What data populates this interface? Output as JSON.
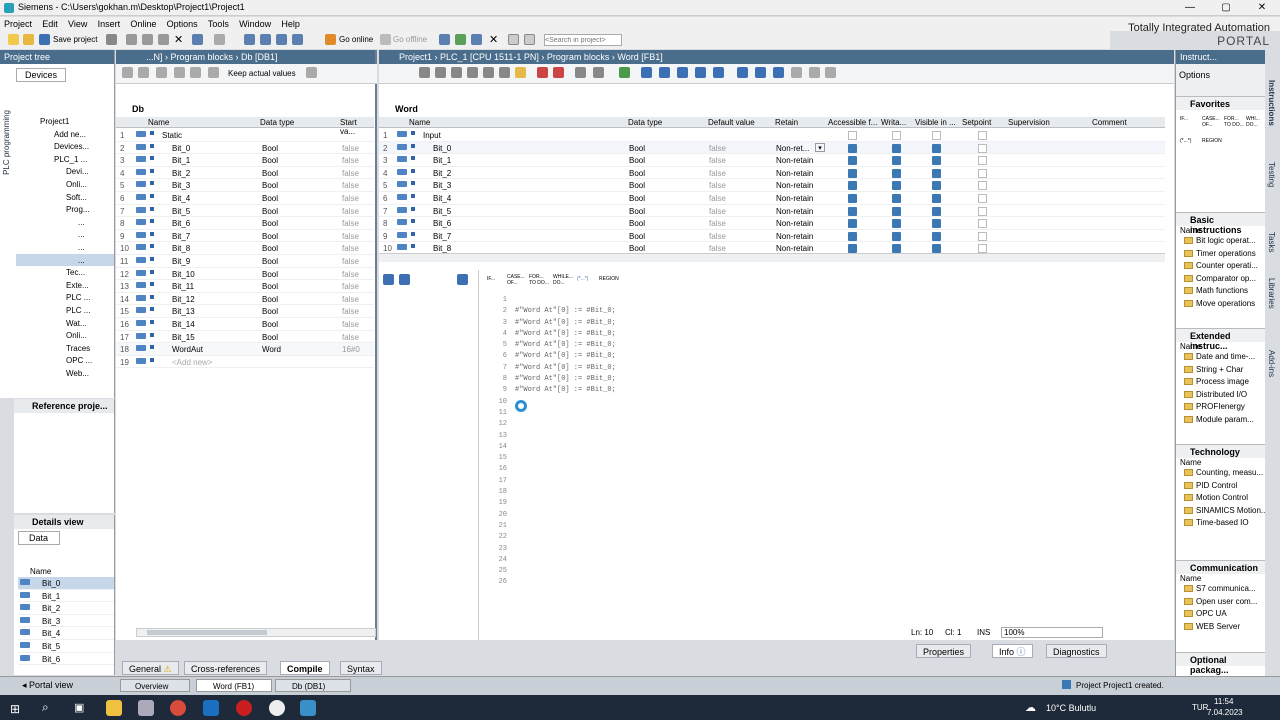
{
  "window": {
    "title": "Siemens  -  C:\\Users\\gokhan.m\\Desktop\\Project1\\Project1"
  },
  "menu": [
    "Project",
    "Edit",
    "View",
    "Insert",
    "Online",
    "Options",
    "Tools",
    "Window",
    "Help"
  ],
  "toolbar": {
    "save": "Save project",
    "go_online": "Go online",
    "go_offline": "Go offline",
    "search_placeholder": "<Search in project>"
  },
  "brand": {
    "line1": "Totally Integrated Automation",
    "line2": "PORTAL"
  },
  "project_tree": {
    "title": "Project tree",
    "devices_tab": "Devices",
    "side_label": "PLC programming",
    "items": [
      "Project1",
      "Add ne...",
      "Devices...",
      "PLC_1 ...",
      "Devi...",
      "Onli...",
      "Soft...",
      "Prog...",
      "...",
      "...",
      "...",
      "...",
      "Tec...",
      "Exte...",
      "PLC ...",
      "PLC ...",
      "Wat...",
      "Onli...",
      "Traces",
      "OPC ...",
      "Web..."
    ]
  },
  "reference": {
    "title": "Reference proje..."
  },
  "details": {
    "title": "Details view",
    "tab": "Data",
    "col": "Name",
    "items": [
      "Bit_0",
      "Bit_1",
      "Bit_2",
      "Bit_3",
      "Bit_4",
      "Bit_5",
      "Bit_6"
    ]
  },
  "db_editor": {
    "breadcrumb": "...N]  ›  Program blocks  ›  Db [DB1]",
    "keep_actual": "Keep actual values",
    "block_name": "Db",
    "cols": [
      "Name",
      "Data type",
      "Start va..."
    ],
    "rows": [
      {
        "n": "1",
        "name": "Static",
        "type": "",
        "start": ""
      },
      {
        "n": "2",
        "name": "Bit_0",
        "type": "Bool",
        "start": "false"
      },
      {
        "n": "3",
        "name": "Bit_1",
        "type": "Bool",
        "start": "false"
      },
      {
        "n": "4",
        "name": "Bit_2",
        "type": "Bool",
        "start": "false"
      },
      {
        "n": "5",
        "name": "Bit_3",
        "type": "Bool",
        "start": "false"
      },
      {
        "n": "6",
        "name": "Bit_4",
        "type": "Bool",
        "start": "false"
      },
      {
        "n": "7",
        "name": "Bit_5",
        "type": "Bool",
        "start": "false"
      },
      {
        "n": "8",
        "name": "Bit_6",
        "type": "Bool",
        "start": "false"
      },
      {
        "n": "9",
        "name": "Bit_7",
        "type": "Bool",
        "start": "false"
      },
      {
        "n": "10",
        "name": "Bit_8",
        "type": "Bool",
        "start": "false"
      },
      {
        "n": "11",
        "name": "Bit_9",
        "type": "Bool",
        "start": "false"
      },
      {
        "n": "12",
        "name": "Bit_10",
        "type": "Bool",
        "start": "false"
      },
      {
        "n": "13",
        "name": "Bit_11",
        "type": "Bool",
        "start": "false"
      },
      {
        "n": "14",
        "name": "Bit_12",
        "type": "Bool",
        "start": "false"
      },
      {
        "n": "15",
        "name": "Bit_13",
        "type": "Bool",
        "start": "false"
      },
      {
        "n": "16",
        "name": "Bit_14",
        "type": "Bool",
        "start": "false"
      },
      {
        "n": "17",
        "name": "Bit_15",
        "type": "Bool",
        "start": "false"
      },
      {
        "n": "18",
        "name": "WordAut",
        "type": "Word",
        "start": "16#0"
      },
      {
        "n": "19",
        "name": "<Add new>",
        "type": "",
        "start": ""
      }
    ]
  },
  "fb_editor": {
    "breadcrumb": "Project1  ›  PLC_1 [CPU 1511-1 PN]  ›  Program blocks  ›  Word [FB1]",
    "block_name": "Word",
    "cols": [
      "Name",
      "Data type",
      "Default value",
      "Retain",
      "Accessible f...",
      "Writa...",
      "Visible in ...",
      "Setpoint",
      "Supervision",
      "Comment"
    ],
    "rows": [
      {
        "n": "1",
        "name": "Input",
        "type": "",
        "def": "",
        "ret": ""
      },
      {
        "n": "2",
        "name": "Bit_0",
        "type": "Bool",
        "def": "false",
        "ret": "Non-ret..."
      },
      {
        "n": "3",
        "name": "Bit_1",
        "type": "Bool",
        "def": "false",
        "ret": "Non-retain"
      },
      {
        "n": "4",
        "name": "Bit_2",
        "type": "Bool",
        "def": "false",
        "ret": "Non-retain"
      },
      {
        "n": "5",
        "name": "Bit_3",
        "type": "Bool",
        "def": "false",
        "ret": "Non-retain"
      },
      {
        "n": "6",
        "name": "Bit_4",
        "type": "Bool",
        "def": "false",
        "ret": "Non-retain"
      },
      {
        "n": "7",
        "name": "Bit_5",
        "type": "Bool",
        "def": "false",
        "ret": "Non-retain"
      },
      {
        "n": "8",
        "name": "Bit_6",
        "type": "Bool",
        "def": "false",
        "ret": "Non-retain"
      },
      {
        "n": "9",
        "name": "Bit_7",
        "type": "Bool",
        "def": "false",
        "ret": "Non-retain"
      },
      {
        "n": "10",
        "name": "Bit_8",
        "type": "Bool",
        "def": "false",
        "ret": "Non-retain"
      }
    ],
    "scl_toolbar": [
      "IF...",
      "CASE... OF...",
      "FOR... TO DO...",
      "WHILE... DO...",
      "(*...*)",
      "REGION"
    ],
    "code_lines": [
      "",
      "#\"Word At\"[0] := #Bit_0;",
      "#\"Word At\"[0] := #Bit_0;",
      "#\"Word At\"[0] := #Bit_0;",
      "#\"Word At\"[0] := #Bit_0;",
      "#\"Word At\"[0] := #Bit_0;",
      "#\"Word At\"[0] := #Bit_0;",
      "#\"Word At\"[0] := #Bit_0;",
      "#\"Word At\"[0] := #Bit_0;",
      "",
      "",
      "",
      "",
      "",
      "",
      "",
      "",
      "",
      "",
      "",
      "",
      "",
      "",
      "",
      "",
      ""
    ],
    "status": {
      "ln": "Ln: 10",
      "cl": "Cl: 1",
      "ins": "INS",
      "zoom": "100%"
    }
  },
  "bottom_tabs": [
    "General",
    "Cross-references",
    "Compile",
    "Syntax"
  ],
  "inspector_tabs": [
    "Properties",
    "Info",
    "Diagnostics"
  ],
  "portal_view": "Portal view",
  "open_editors": [
    "Overview",
    "Word (FB1)",
    "Db (DB1)"
  ],
  "status_msg": "Project Project1 created.",
  "instructions": {
    "title": "Instruct...",
    "options": "Options",
    "sections": [
      {
        "title": "Favorites",
        "items": []
      },
      {
        "title": "Basic instructions",
        "col": "Name",
        "items": [
          "Bit logic operat...",
          "Timer operations",
          "Counter operati...",
          "Comparator op...",
          "Math functions",
          "Move operations"
        ]
      },
      {
        "title": "Extended instruc...",
        "col": "Name",
        "items": [
          "Date and time-...",
          "String + Char",
          "Process image",
          "Distributed I/O",
          "PROFIenergy",
          "Module param..."
        ]
      },
      {
        "title": "Technology",
        "col": "Name",
        "items": [
          "Counting, measu...",
          "PID Control",
          "Motion Control",
          "SINAMICS Motion...",
          "Time-based IO"
        ]
      },
      {
        "title": "Communication",
        "col": "Name",
        "items": [
          "S7 communica...",
          "Open user com...",
          "OPC UA",
          "WEB Server"
        ]
      },
      {
        "title": "Optional packag...",
        "col": "",
        "items": []
      }
    ],
    "fav_items": [
      "IF...",
      "CASE... OF...",
      "FOR... TO DO...",
      "WHI... DO...",
      "(*...*)",
      "REGION"
    ],
    "side_tabs": [
      "Instructions",
      "Testing",
      "Tasks",
      "Libraries",
      "Add-ins"
    ]
  },
  "taskbar": {
    "weather": "10°C  Bulutlu",
    "lang": "TUR",
    "time": "11:54",
    "date": "7.04.2023"
  }
}
